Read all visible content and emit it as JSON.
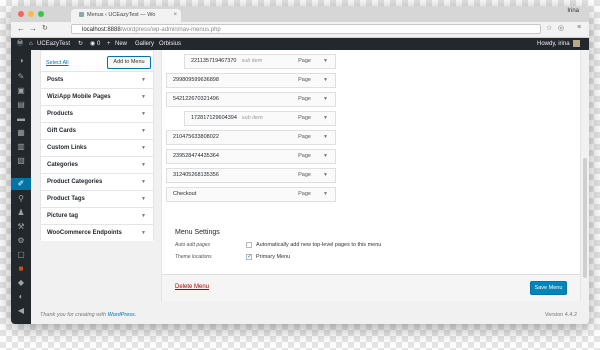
{
  "browser": {
    "tab_title": "Menus ‹ UCEazyTest — Wo",
    "window_user": "Irina",
    "url_host": "localhost:8888",
    "url_path": "/wordpress/wp-admin/nav-menus.php"
  },
  "admin_bar": {
    "site_name": "UCEazyTest",
    "comments_count": "0",
    "new_label": "New",
    "gallery_label": "Gallery",
    "orbisius_label": "Orbisius",
    "howdy": "Howdy, irina"
  },
  "left_panel": {
    "select_all": "Select All",
    "add_to_menu": "Add to Menu",
    "sections": [
      "Posts",
      "WiziApp Mobile Pages",
      "Products",
      "Gift Cards",
      "Custom Links",
      "Categories",
      "Product Categories",
      "Product Tags",
      "Picture tag",
      "WooCommerce Endpoints"
    ]
  },
  "menu_items": [
    {
      "title": "221135719467370",
      "sub": "sub item",
      "type": "Page",
      "depth": 1
    },
    {
      "title": "299809599636898",
      "sub": "",
      "type": "Page",
      "depth": 0
    },
    {
      "title": "542122670321496",
      "sub": "",
      "type": "Page",
      "depth": 0
    },
    {
      "title": "172817129604394",
      "sub": "sub item",
      "type": "Page",
      "depth": 1
    },
    {
      "title": "210475633808022",
      "sub": "",
      "type": "Page",
      "depth": 0
    },
    {
      "title": "239528474435364",
      "sub": "",
      "type": "Page",
      "depth": 0
    },
    {
      "title": "312405268135356",
      "sub": "",
      "type": "Page",
      "depth": 0
    },
    {
      "title": "Checkout",
      "sub": "",
      "type": "Page",
      "depth": 0
    }
  ],
  "menu_settings": {
    "title": "Menu Settings",
    "auto_add_label": "Auto add pages",
    "auto_add_text": "Automatically add new top-level pages to this menu",
    "auto_add_checked": false,
    "theme_locations_label": "Theme locations",
    "primary_menu_text": "Primary Menu",
    "primary_menu_checked": true
  },
  "actions": {
    "delete_menu": "Delete Menu",
    "save_menu": "Save Menu"
  },
  "footer": {
    "thanks_prefix": "Thank you for creating with ",
    "wordpress_link": "WordPress",
    "thanks_suffix": ".",
    "version": "Version 4.4.2"
  },
  "colors": {
    "admin_bar": "#23282d",
    "accent": "#0073aa",
    "primary_button": "#0085ba",
    "delete": "#a00"
  }
}
